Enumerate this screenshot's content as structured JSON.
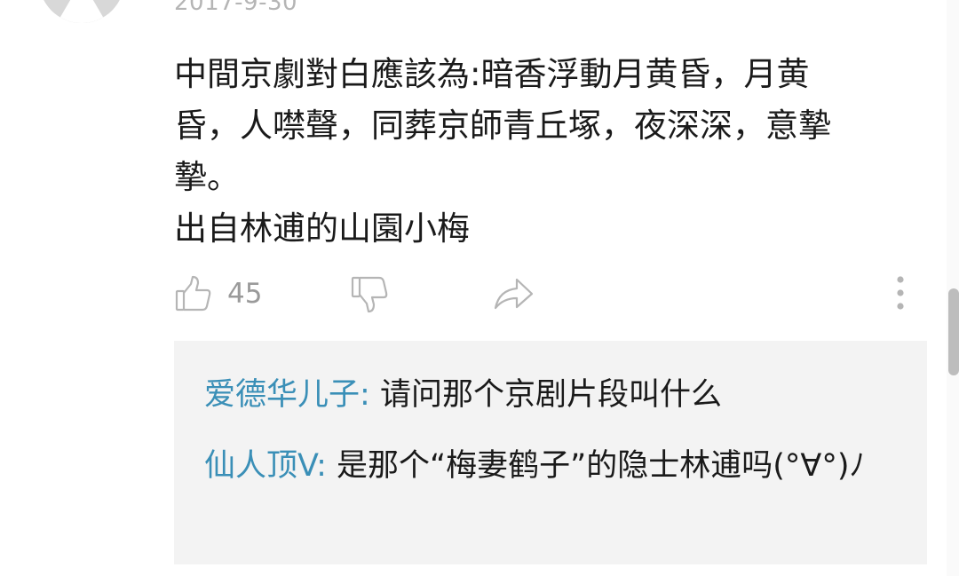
{
  "comment": {
    "timestamp": "2017-9-30",
    "lines": [
      "中間京劇對白應該為:暗香浮動月黄昏，月黄",
      "昏，人噤聲，同葬京師青丘塚，夜深深，意摯",
      "摯。",
      "出自林逋的山園小梅"
    ],
    "like_count": "45"
  },
  "icons": {
    "like": "thumbs-up-icon",
    "dislike": "thumbs-down-icon",
    "share": "share-arrow-icon",
    "more": "more-vertical-icon",
    "avatar": "avatar-icon"
  },
  "replies": [
    {
      "author": "爱德华儿子",
      "separator": ":",
      "text": " 请问那个京剧片段叫什么"
    },
    {
      "author": "仙人顶V",
      "separator": ":",
      "text": " 是那个“梅妻鹤子”的隐士林逋吗(°∀°)ﾉ"
    }
  ],
  "colors": {
    "author_link": "#3a8fb7",
    "reply_background": "#f3f3f3",
    "icon_gray": "#b5b5b5",
    "text": "#1a1a1a"
  }
}
